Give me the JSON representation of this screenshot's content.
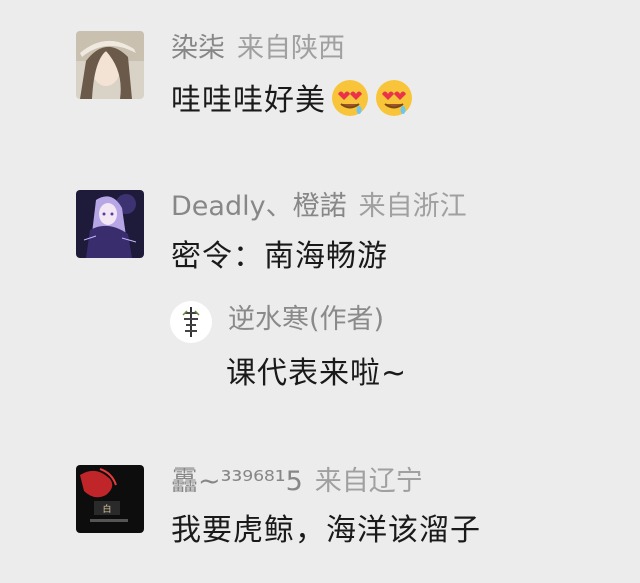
{
  "comments": [
    {
      "username": "染柒",
      "location": "来自陕西",
      "text": "哇哇哇好美",
      "emojis": [
        "heart-eyes-drool-emoji",
        "heart-eyes-drool-emoji"
      ]
    },
    {
      "username": "Deadly、橙諾",
      "location": "来自浙江",
      "text": "密令：南海畅游",
      "reply": {
        "username": "逆水寒(作者)",
        "text": "课代表来啦~"
      }
    },
    {
      "username": "靐~³³⁹⁶⁸¹5",
      "location": "来自辽宁",
      "text": "我要虎鲸，海洋该溜子"
    }
  ],
  "colors": {
    "background": "#ececed",
    "meta_text": "#8a8a8a",
    "body_text": "#1a1a1a"
  }
}
